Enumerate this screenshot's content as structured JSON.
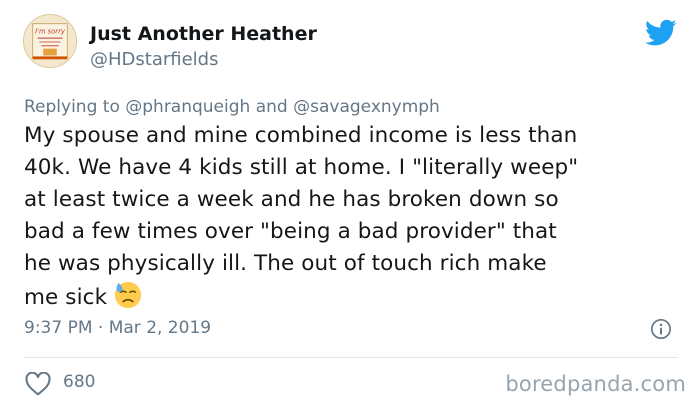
{
  "colors": {
    "twitter_blue": "#1DA1F2",
    "muted": "#657786",
    "text": "#14171a"
  },
  "tweet": {
    "display_name": "Just Another Heather",
    "handle": "@HDstarfields",
    "reply_prefix": "Replying to",
    "reply_mention_1": "@phranqueigh",
    "reply_and": "and",
    "reply_mention_2": "@savagexnymph",
    "body_lines": [
      "My spouse and mine combined income is less than",
      "40k. We have 4 kids still at home. I \"literally weep\"",
      "at least twice a week and he has broken down so",
      "bad a few times over \"being a bad provider\" that",
      "he was physically ill.  The out of touch rich make",
      "me sick"
    ],
    "emoji": "downcast-face-with-sweat",
    "timestamp": "9:37 PM · Mar 2, 2019",
    "like_count": "680",
    "avatar_text": "I'm sorry"
  },
  "watermark": "boredpanda.com",
  "icons": {
    "brand": "twitter-bird-icon",
    "info": "info-icon",
    "like": "heart-icon"
  }
}
